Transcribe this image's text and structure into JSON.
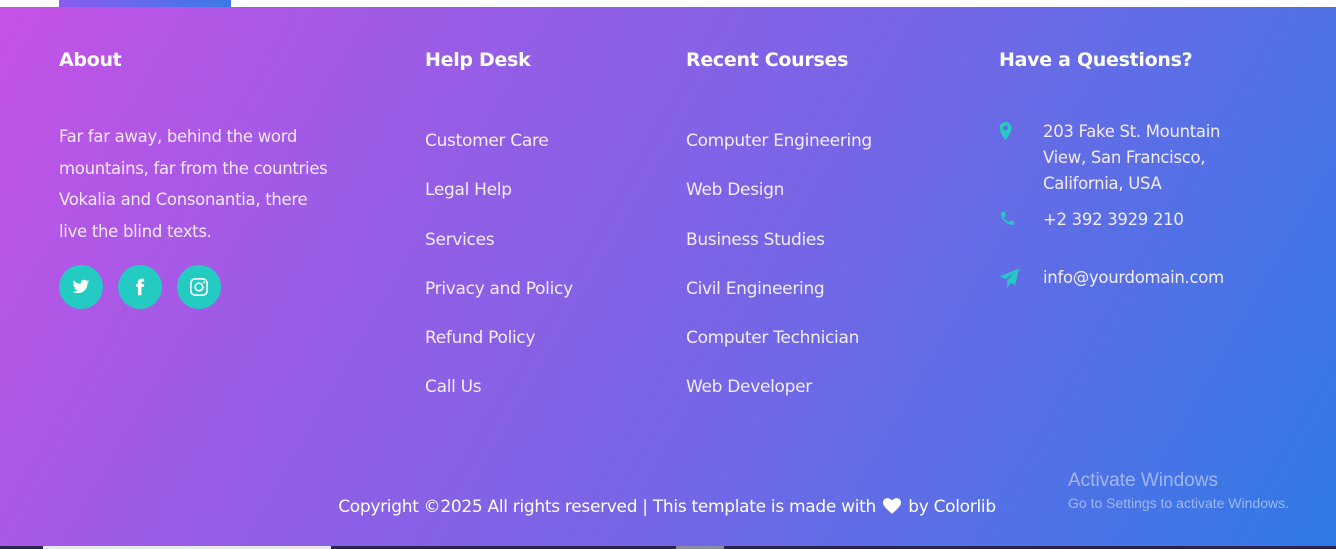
{
  "about": {
    "title": "About",
    "text": "Far far away, behind the word mountains, far from the countries Vokalia and Consonantia, there live the blind texts.",
    "socials": [
      "twitter-icon",
      "facebook-icon",
      "instagram-icon"
    ]
  },
  "help_desk": {
    "title": "Help Desk",
    "links": [
      "Customer Care",
      "Legal Help",
      "Services",
      "Privacy and Policy",
      "Refund Policy",
      "Call Us"
    ]
  },
  "recent_courses": {
    "title": "Recent Courses",
    "links": [
      "Computer Engineering",
      "Web Design",
      "Business Studies",
      "Civil Engineering",
      "Computer Technician",
      "Web Developer"
    ]
  },
  "questions": {
    "title": "Have a Questions?",
    "address": "203 Fake St. Mountain View, San Francisco, California, USA",
    "phone": "+2 392 3929 210",
    "email": "info@yourdomain.com"
  },
  "copyright": {
    "before": "Copyright ©2025 All rights reserved | This template is made with",
    "after": "by Colorlib"
  },
  "windows_watermark": {
    "line1": "Activate Windows",
    "line2": "Go to Settings to activate Windows."
  },
  "colors": {
    "gradient_start": "#c552e6",
    "gradient_end": "#2f7ae6",
    "accent": "#24cbc3"
  }
}
